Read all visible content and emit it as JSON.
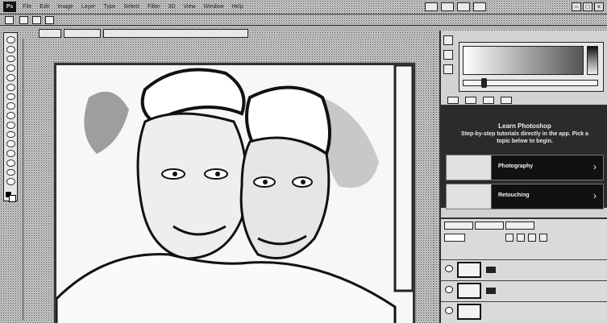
{
  "app": {
    "logo_text": "Ps",
    "menu": [
      "File",
      "Edit",
      "Image",
      "Layer",
      "Type",
      "Select",
      "Filter",
      "3D",
      "View",
      "Window",
      "Help"
    ]
  },
  "window_controls": [
    "–",
    "□",
    "×"
  ],
  "learn_panel": {
    "title": "Learn Photoshop",
    "subtitle": "Step-by-step tutorials directly in the app. Pick a topic below to begin.",
    "cards": [
      {
        "label": "Photography"
      },
      {
        "label": "Retouching"
      }
    ],
    "arrow_icon": "chevron-right-icon"
  },
  "colors": {
    "panel_dark": "#2b2b2b",
    "card_bg": "#111111"
  }
}
